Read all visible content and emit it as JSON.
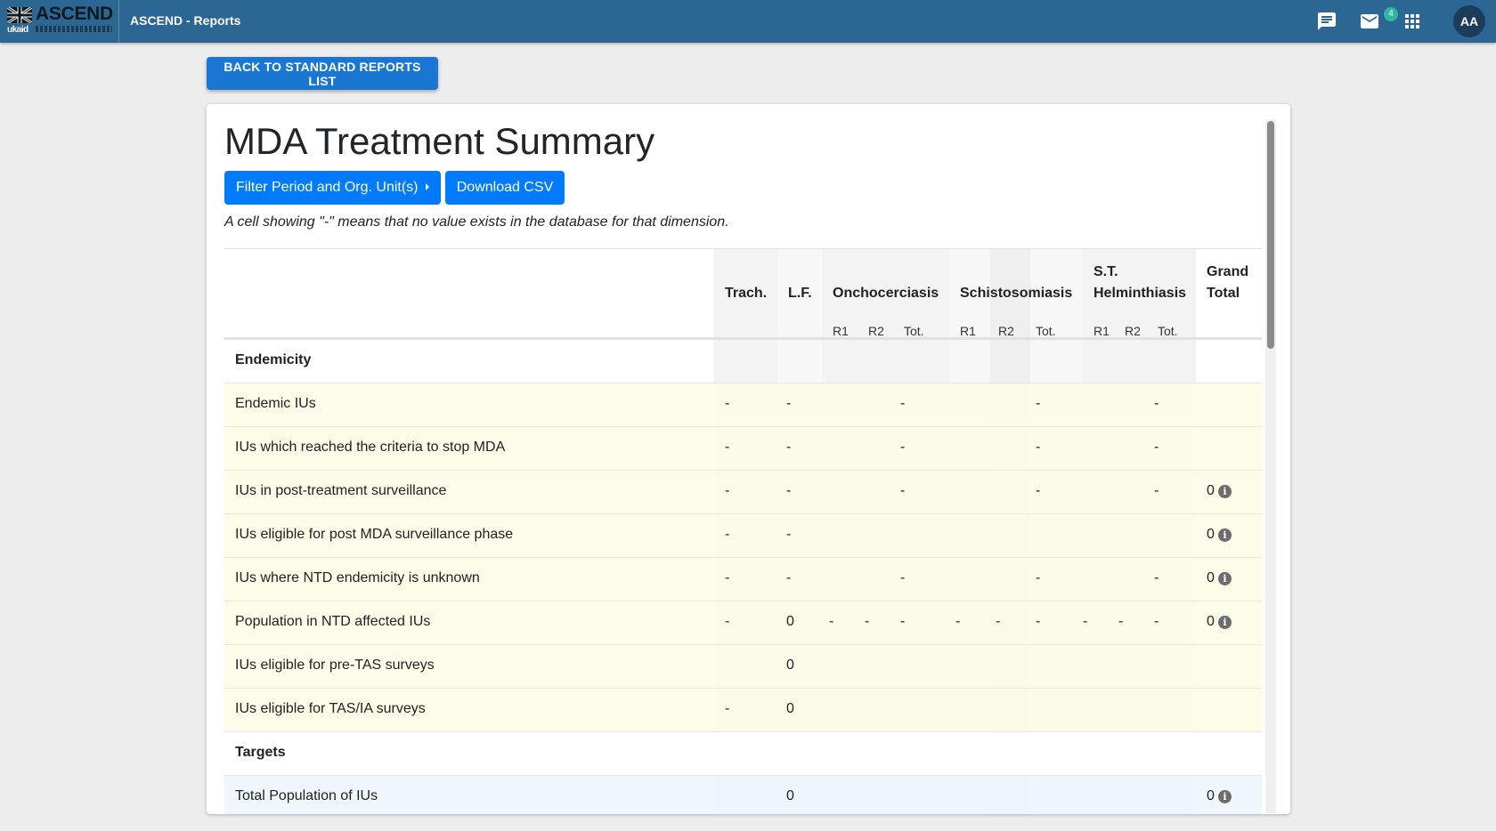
{
  "header": {
    "logo_text": "ASCEND",
    "logo_subtext": "ukaid",
    "app_title": "ASCEND - Reports",
    "mail_badge": "4",
    "avatar_initials": "AA",
    "icons": [
      "chat-icon",
      "mail-icon",
      "apps-grid-icon"
    ]
  },
  "back_button": "BACK TO STANDARD REPORTS LIST",
  "report": {
    "title": "MDA Treatment Summary",
    "filter_button": "Filter Period and Org. Unit(s)",
    "csv_button": "Download CSV",
    "note": "A cell showing \"-\" means that no value exists in the database for that dimension."
  },
  "table": {
    "headers": {
      "trach": "Trach.",
      "lf": "L.F.",
      "oncho": "Onchocerciasis",
      "schisto": "Schistosomiasis",
      "sth_line1": "S.T.",
      "sth_line2": "Helminthiasis",
      "grand_line1": "Grand",
      "grand_line2": "Total",
      "r1": "R1",
      "r2": "R2",
      "tot": "Tot."
    },
    "sections": {
      "endemicity": "Endemicity",
      "targets": "Targets"
    },
    "rows": [
      {
        "label": "Endemic IUs",
        "cells": [
          "-",
          "-",
          "",
          "",
          "-",
          "",
          "",
          "-",
          "",
          "",
          "-",
          ""
        ]
      },
      {
        "label": "IUs which reached the criteria to stop MDA",
        "cells": [
          "-",
          "-",
          "",
          "",
          "-",
          "",
          "",
          "-",
          "",
          "",
          "-",
          ""
        ]
      },
      {
        "label": "IUs in post-treatment surveillance",
        "cells": [
          "-",
          "-",
          "",
          "",
          "-",
          "",
          "",
          "-",
          "",
          "",
          "-",
          "0"
        ]
      },
      {
        "label": "IUs eligible for post MDA surveillance phase",
        "cells": [
          "-",
          "-",
          "",
          "",
          "",
          "",
          "",
          "",
          "",
          "",
          "",
          "0"
        ]
      },
      {
        "label": "IUs where NTD endemicity is unknown",
        "cells": [
          "-",
          "-",
          "",
          "",
          "-",
          "",
          "",
          "-",
          "",
          "",
          "-",
          "0"
        ]
      },
      {
        "label": "Population in NTD affected IUs",
        "cells": [
          "-",
          "0",
          "-",
          "-",
          "-",
          "-",
          "-",
          "-",
          "-",
          "-",
          "-",
          "0"
        ]
      },
      {
        "label": "IUs eligible for pre-TAS surveys",
        "cells": [
          "",
          "0",
          "",
          "",
          "",
          "",
          "",
          "",
          "",
          "",
          "",
          ""
        ]
      },
      {
        "label": "IUs eligible for TAS/IA surveys",
        "cells": [
          "-",
          "0",
          "",
          "",
          "",
          "",
          "",
          "",
          "",
          "",
          "",
          ""
        ]
      },
      {
        "label": "Total Population of IUs",
        "cells": [
          "",
          "0",
          "",
          "",
          "",
          "",
          "",
          "",
          "",
          "",
          "",
          "0"
        ]
      }
    ]
  }
}
